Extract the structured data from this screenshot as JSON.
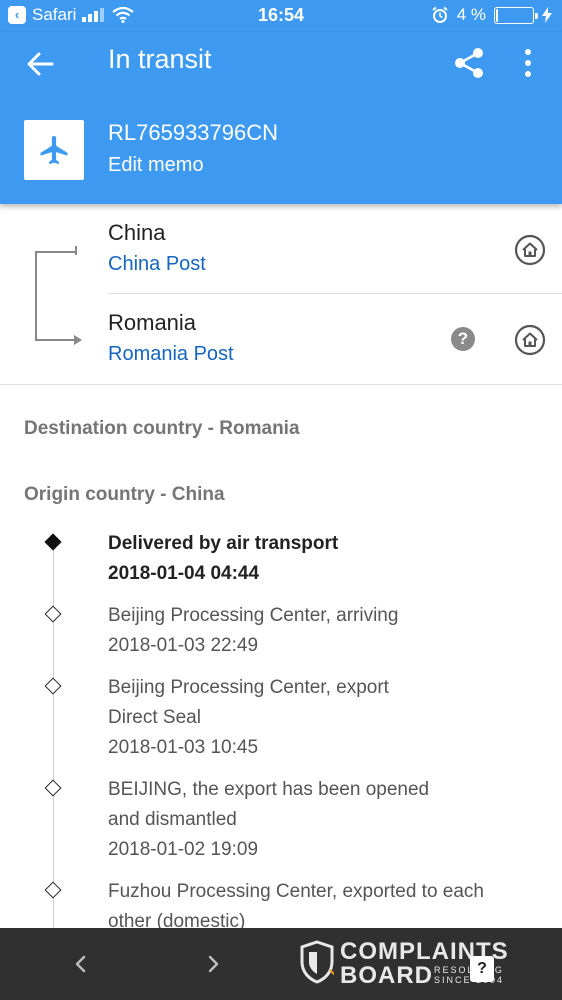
{
  "status_bar": {
    "app": "Safari",
    "time": "16:54",
    "battery_text": "4 %",
    "battery_level": 0.04,
    "icons": [
      "back-app-icon",
      "signal-icon",
      "wifi-icon",
      "alarm-icon",
      "battery-icon",
      "charging-icon"
    ]
  },
  "app_bar": {
    "title": "In transit",
    "tracking_number": "RL765933796CN",
    "edit_memo": "Edit memo",
    "icons": [
      "back-arrow-icon",
      "share-icon",
      "more-vert-icon",
      "airplane-icon"
    ]
  },
  "route": {
    "origin": {
      "country": "China",
      "carrier": "China Post"
    },
    "destination": {
      "country": "Romania",
      "carrier": "Romania Post",
      "help": "?"
    }
  },
  "sections": {
    "destination": "Destination country - Romania",
    "origin": "Origin country - China"
  },
  "events": [
    {
      "lines": [
        "Delivered by air transport",
        "2018-01-04 04:44"
      ],
      "current": true
    },
    {
      "lines": [
        "Beijing Processing Center, arriving",
        "2018-01-03 22:49"
      ],
      "current": false
    },
    {
      "lines": [
        "Beijing Processing Center, export",
        "Direct Seal",
        "2018-01-03 10:45"
      ],
      "current": false
    },
    {
      "lines": [
        "BEIJING, the export has been opened",
        "and dismantled",
        "2018-01-02 19:09"
      ],
      "current": false
    },
    {
      "lines": [
        "Fuzhou Processing Center, exported to each",
        "other (domestic)"
      ],
      "current": false
    }
  ],
  "bottom_bar": {
    "watermark": {
      "line1": "COMPLAINTS",
      "line2": "BOARD",
      "small1": "RESOLVING",
      "small2": "SINCE 2004",
      "help": "?"
    }
  },
  "colors": {
    "primary": "#3d9af0",
    "link": "#1565c0",
    "bottom_bar": "#303030"
  }
}
